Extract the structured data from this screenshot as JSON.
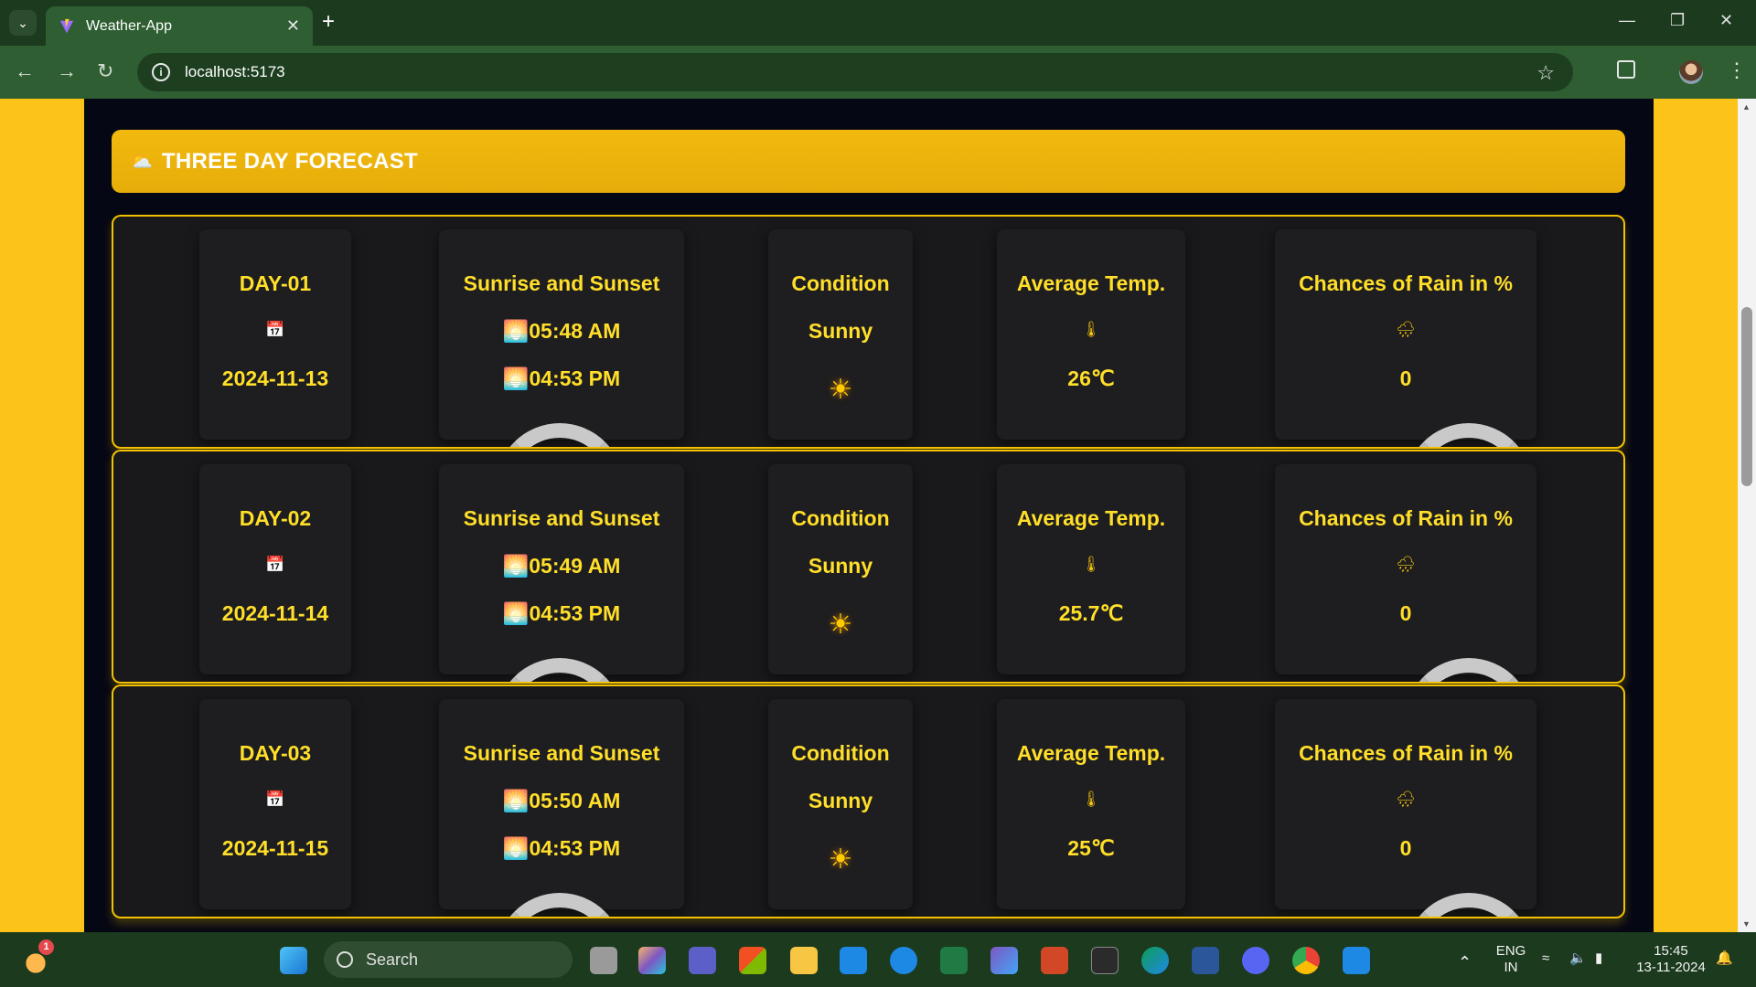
{
  "browser": {
    "tab_title": "Weather-App",
    "url": "localhost:5173"
  },
  "forecast": {
    "title": "THREE DAY FORECAST",
    "days": [
      {
        "day": "DAY-01",
        "date": "2024-11-13",
        "sun_heading": "Sunrise and Sunset",
        "sunrise": "05:48 AM",
        "sunset": "04:53 PM",
        "condition_heading": "Condition",
        "condition": "Sunny",
        "temp_heading": "Average Temp.",
        "temp": "26",
        "temp_unit": "℃",
        "rain_heading": "Chances of Rain in %",
        "rain": "0"
      },
      {
        "day": "DAY-02",
        "date": "2024-11-14",
        "sun_heading": "Sunrise and Sunset",
        "sunrise": "05:49 AM",
        "sunset": "04:53 PM",
        "condition_heading": "Condition",
        "condition": "Sunny",
        "temp_heading": "Average Temp.",
        "temp": "25.7",
        "temp_unit": "℃",
        "rain_heading": "Chances of Rain in %",
        "rain": "0"
      },
      {
        "day": "DAY-03",
        "date": "2024-11-15",
        "sun_heading": "Sunrise and Sunset",
        "sunrise": "05:50 AM",
        "sunset": "04:53 PM",
        "condition_heading": "Condition",
        "condition": "Sunny",
        "temp_heading": "Average Temp.",
        "temp": "25",
        "temp_unit": "℃",
        "rain_heading": "Chances of Rain in %",
        "rain": "0"
      }
    ]
  },
  "taskbar": {
    "search_placeholder": "Search",
    "weather_badge": "1",
    "lang_top": "ENG",
    "lang_bottom": "IN",
    "time": "15:45",
    "date": "13-11-2024"
  },
  "colors": {
    "accent_yellow": "#f2b90e",
    "text_yellow": "#ffdf2a",
    "card_bg": "#19181a",
    "chrome_green": "#2e5e31"
  }
}
